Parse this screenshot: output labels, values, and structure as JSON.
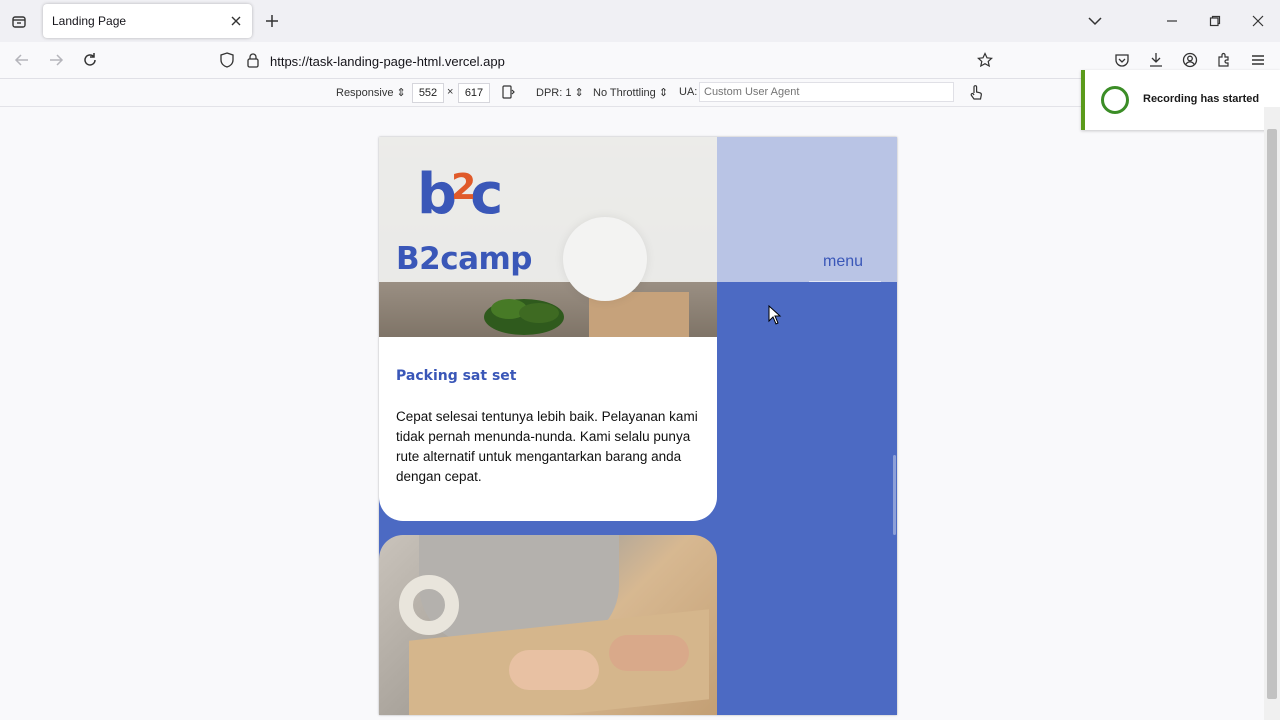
{
  "browser": {
    "tab": {
      "title": "Landing Page"
    },
    "url": "https://task-landing-page-html.vercel.app"
  },
  "rdm": {
    "device": "Responsive",
    "width": "552",
    "separator": "×",
    "height": "617",
    "dpr": "DPR: 1",
    "throttling": "No Throttling",
    "ua_label": "UA:",
    "ua_placeholder": "Custom User Agent"
  },
  "page": {
    "brand": "B2camp",
    "logo_letters": {
      "b": "b",
      "two": "2",
      "c": "c"
    },
    "menu": "menu",
    "card": {
      "title": "Packing sat set",
      "text": "Cepat selesai tentunya lebih baik. Pelayanan kami tidak pernah menunda-nunda. Kami selalu punya rute alternatif untuk mengantarkan barang anda dengan cepat."
    }
  },
  "notification": {
    "text": "Recording has started"
  },
  "colors": {
    "brand_blue": "#3a57b8",
    "panel_blue": "#4c6ac3",
    "accent_orange": "#e05a2a"
  }
}
